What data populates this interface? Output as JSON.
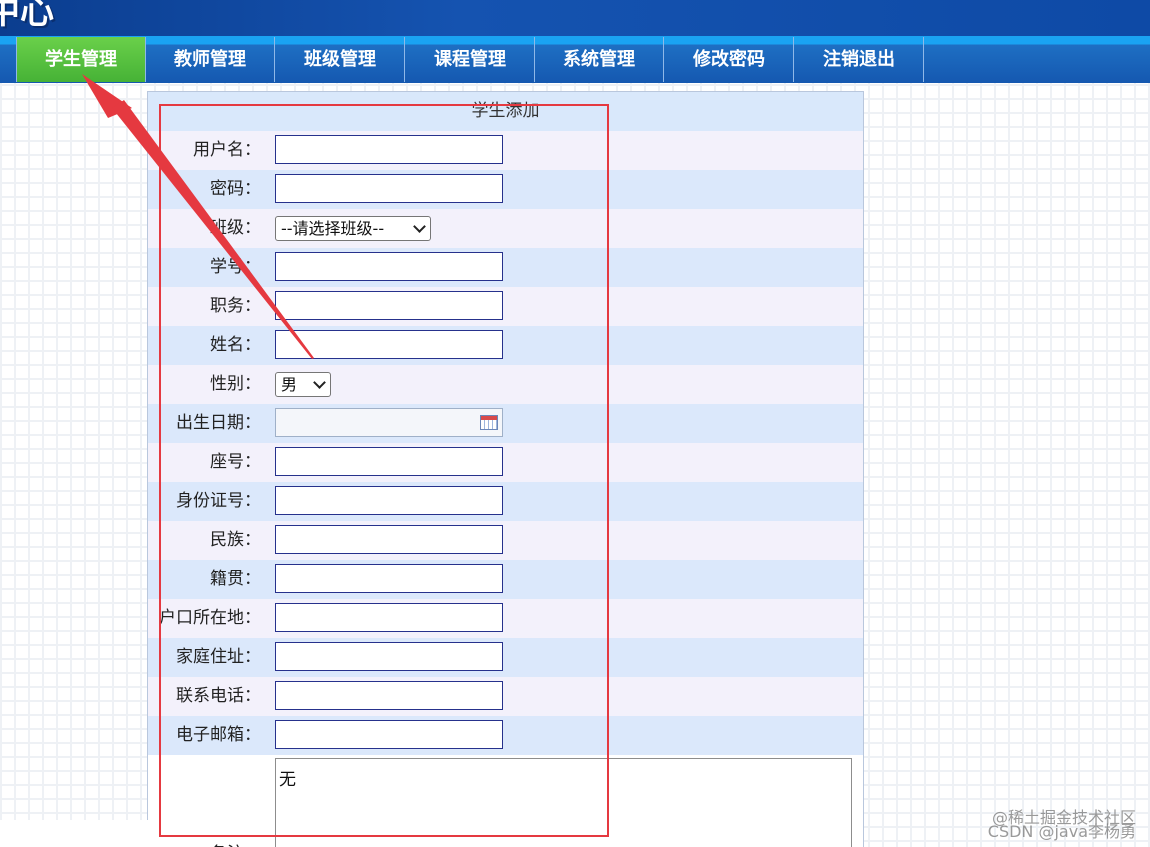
{
  "banner": {
    "title_fragment": "中心"
  },
  "nav": {
    "items": [
      {
        "label": "学生管理",
        "active": true
      },
      {
        "label": "教师管理"
      },
      {
        "label": "班级管理"
      },
      {
        "label": "课程管理"
      },
      {
        "label": "系统管理"
      },
      {
        "label": "修改密码"
      },
      {
        "label": "注销退出"
      }
    ]
  },
  "form": {
    "title": "学生添加",
    "fields": {
      "username": "用户名：",
      "password": "密码：",
      "class": "班级：",
      "student_no": "学号：",
      "position": "职务：",
      "name": "姓名：",
      "gender": "性别：",
      "birth_date": "出生日期：",
      "seat_no": "座号：",
      "id_card": "身份证号：",
      "ethnicity": "民族：",
      "native_place": "籍贯：",
      "household": "户口所在地：",
      "home_address": "家庭住址：",
      "phone": "联系电话：",
      "email": "电子邮箱：",
      "remark": "备注："
    },
    "class_select": {
      "selected": "--请选择班级--"
    },
    "gender_select": {
      "selected": "男"
    },
    "remark_value": "无"
  },
  "watermarks": {
    "line1": "@稀土掘金技术社区",
    "line2": "CSDN @java李杨勇"
  },
  "colors": {
    "nav_active": "#46b236",
    "nav_bar": "#1558b0",
    "highlight": "#e53940"
  }
}
